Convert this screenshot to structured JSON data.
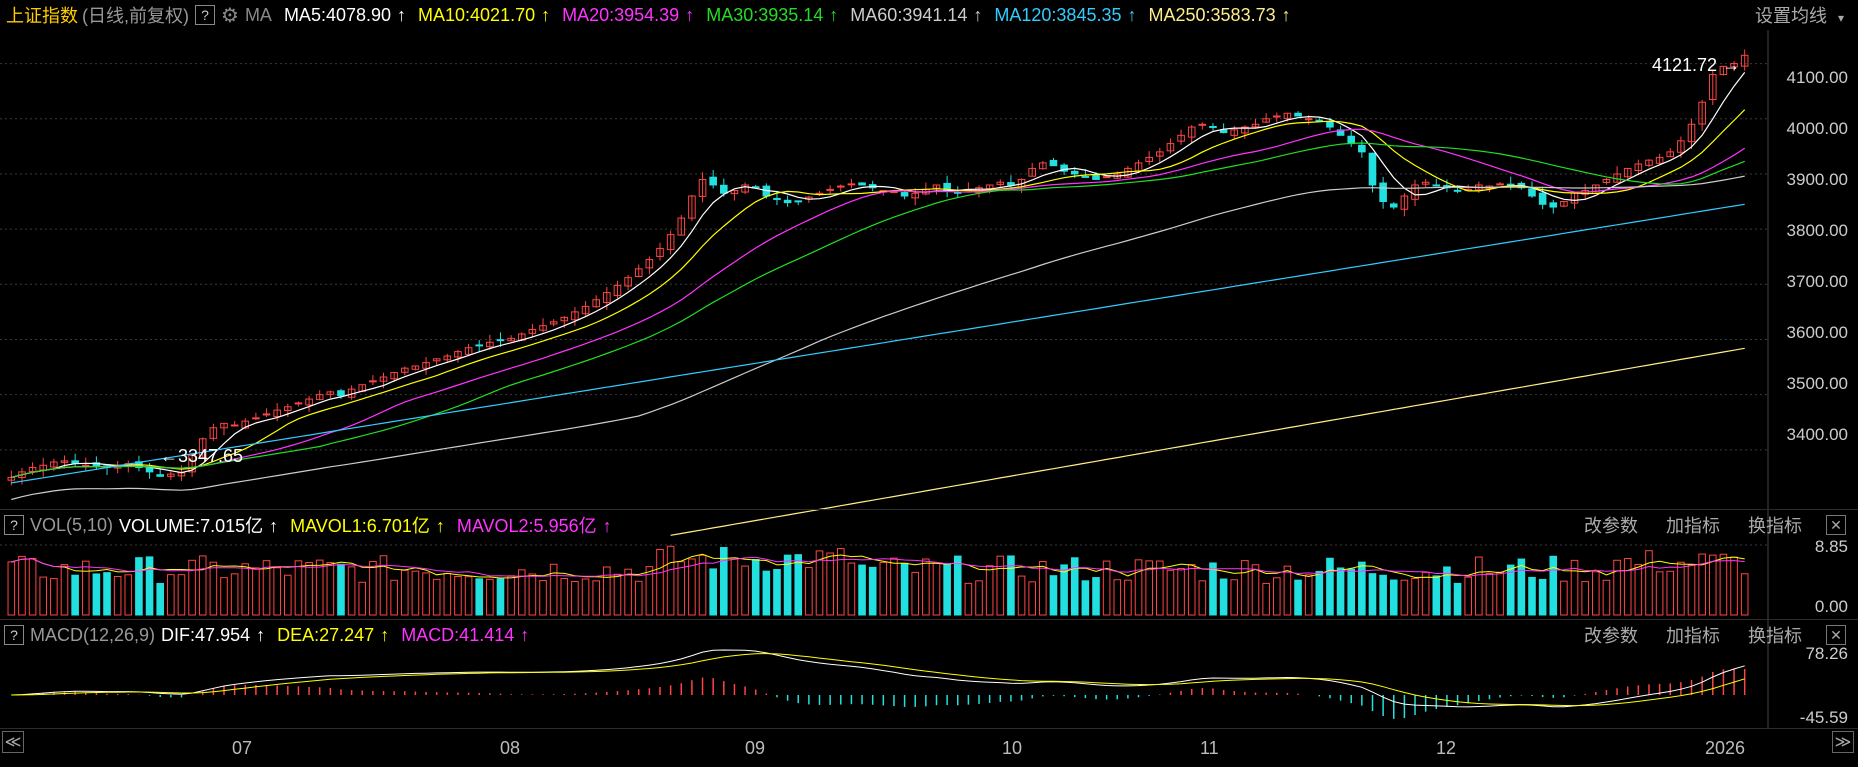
{
  "header": {
    "title": "上证指数",
    "subtitle": "(日线,前复权)",
    "help": "?",
    "ma_label": "MA",
    "ma_values": [
      {
        "label": "MA5:4078.90",
        "arrow": "↑",
        "color": "#ffffff"
      },
      {
        "label": "MA10:4021.70",
        "arrow": "↑",
        "color": "#ffff00"
      },
      {
        "label": "MA20:3954.39",
        "arrow": "↑",
        "color": "#ff33ff"
      },
      {
        "label": "MA30:3935.14",
        "arrow": "↑",
        "color": "#22dd22"
      },
      {
        "label": "MA60:3941.14",
        "arrow": "↑",
        "color": "#cccccc"
      },
      {
        "label": "MA120:3845.35",
        "arrow": "↑",
        "color": "#33ccff"
      },
      {
        "label": "MA250:3583.73",
        "arrow": "↑",
        "color": "#ffee88"
      }
    ],
    "settings": "设置均线"
  },
  "price_axis": [
    "4100.00",
    "4000.00",
    "3900.00",
    "3800.00",
    "3700.00",
    "3600.00",
    "3500.00",
    "3400.00"
  ],
  "annotations": {
    "high": "4121.72",
    "low": "3347.65"
  },
  "volume_panel": {
    "help": "?",
    "title": "VOL(5,10)",
    "volume": "VOLUME:7.015亿",
    "mavol1": "MAVOL1:6.701亿",
    "mavol2": "MAVOL2:5.956亿",
    "arrow": "↑",
    "axis": [
      "8.85",
      "0.00"
    ],
    "buttons": [
      "改参数",
      "加指标",
      "换指标"
    ],
    "close": "✕"
  },
  "macd_panel": {
    "help": "?",
    "title": "MACD(12,26,9)",
    "dif": "DIF:47.954",
    "dea": "DEA:27.247",
    "macd": "MACD:41.414",
    "arrow": "↑",
    "axis": [
      "78.26",
      "-45.59"
    ],
    "buttons": [
      "改参数",
      "加指标",
      "换指标"
    ],
    "close": "✕"
  },
  "months": [
    "07",
    "08",
    "09",
    "10",
    "11",
    "12",
    "2026"
  ],
  "nav": {
    "left": "≪",
    "right": "≫"
  },
  "colors": {
    "up": "#ff4444",
    "down": "#22e0e0",
    "grid": "#3a3a3a"
  },
  "chart_data": {
    "type": "candlestick",
    "ylim": [
      3300,
      4150
    ],
    "close": [
      3350,
      3360,
      3368,
      3372,
      3378,
      3380,
      3376,
      3372,
      3370,
      3368,
      3372,
      3375,
      3368,
      3360,
      3352,
      3356,
      3358,
      3390,
      3420,
      3440,
      3448,
      3445,
      3452,
      3458,
      3465,
      3472,
      3478,
      3485,
      3492,
      3500,
      3505,
      3498,
      3510,
      3518,
      3525,
      3532,
      3540,
      3548,
      3552,
      3558,
      3565,
      3570,
      3578,
      3585,
      3590,
      3595,
      3598,
      3602,
      3610,
      3618,
      3625,
      3632,
      3640,
      3650,
      3660,
      3672,
      3685,
      3698,
      3712,
      3728,
      3745,
      3765,
      3790,
      3820,
      3860,
      3890,
      3880,
      3865,
      3870,
      3880,
      3875,
      3860,
      3855,
      3848,
      3850,
      3858,
      3865,
      3872,
      3878,
      3882,
      3880,
      3875,
      3870,
      3868,
      3860,
      3865,
      3872,
      3880,
      3870,
      3865,
      3872,
      3875,
      3880,
      3885,
      3880,
      3890,
      3910,
      3920,
      3915,
      3905,
      3900,
      3895,
      3890,
      3895,
      3900,
      3910,
      3920,
      3930,
      3940,
      3955,
      3970,
      3985,
      3990,
      3985,
      3975,
      3980,
      3985,
      3990,
      4000,
      4005,
      4010,
      4005,
      4000,
      3995,
      3985,
      3970,
      3955,
      3940,
      3880,
      3850,
      3840,
      3860,
      3880,
      3885,
      3880,
      3875,
      3870,
      3872,
      3880,
      3878,
      3882,
      3880,
      3875,
      3860,
      3845,
      3840,
      3850,
      3865,
      3870,
      3880,
      3890,
      3900,
      3910,
      3918,
      3925,
      3930,
      3940,
      3960,
      3990,
      4030,
      4080,
      4095,
      4100,
      4115
    ]
  }
}
